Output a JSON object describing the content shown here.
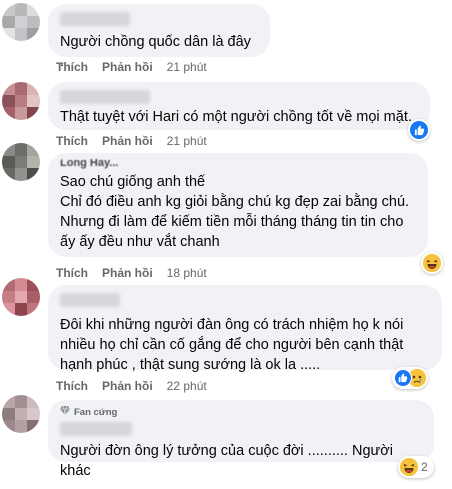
{
  "actions": {
    "like": "Thích",
    "reply": "Phản hồi"
  },
  "comments": [
    {
      "text": "Người chồng quốc dân là đây .",
      "time": "21 phút",
      "avatar_colors": [
        "#c9c9cb",
        "#b8b8bb",
        "#dcdcdd",
        "#a9a8ab",
        "#d0cfd2",
        "#bdbcc0",
        "#e2e2e3",
        "#c3c3c6",
        "#9f9ea2"
      ]
    },
    {
      "text": "Thật tuyệt với Hari có một người chồng tốt về mọi mặt.",
      "time": "21 phút",
      "avatar_colors": [
        "#c48f92",
        "#a86a70",
        "#d8b3b4",
        "#8c5259",
        "#b97c80",
        "#e1c4c4",
        "#a46066",
        "#c99a9c",
        "#7f474d"
      ]
    },
    {
      "author_fragment": "Long Hay...",
      "text": "Sao chú giống anh thế\nChỉ đó điều anh kg giỏi bằng chú kg đẹp zai bằng chú.\nNhưng đi làm để kiếm tiền mỗi tháng tháng tin tin cho ấy ấy đều như vắt chanh",
      "time": "18 phút",
      "avatar_colors": [
        "#8b8a86",
        "#6e6d69",
        "#a5a39e",
        "#5a5955",
        "#7c7b77",
        "#b4b2ad",
        "#696864",
        "#94928e",
        "#4f4e4a"
      ]
    },
    {
      "text": "Đôi khi những người đàn ông có trách nhiệm họ k nói nhiều họ chỉ cần cố gắng để cho người bên cạnh thật hạnh phúc , thật sung sướng là ok la .....",
      "time": "22 phút",
      "avatar_colors": [
        "#b46a72",
        "#d48b92",
        "#9a5059",
        "#c77d85",
        "#e3a7ad",
        "#a85e66",
        "#d9959b",
        "#8e454d",
        "#c2737b"
      ]
    },
    {
      "badge": "Fan cứng",
      "text": "Người đờn ông lý tưởng của cuộc đời .......... Người khác",
      "time": "",
      "avatar_colors": [
        "#b9a6a8",
        "#a28f92",
        "#cdbcbe",
        "#8e7b7e",
        "#c2afb1",
        "#d7c8ca",
        "#9c888b",
        "#b3a0a2",
        "#857174"
      ],
      "reaction_count": "2"
    }
  ],
  "colors": {
    "bubble": "#f0f2f5",
    "meta": "#65676b",
    "like_blue": "#1877f2",
    "haha_yellow": "#f7c33e"
  },
  "icons": [
    "like-icon",
    "haha-icon",
    "sad-icon",
    "diamond-icon"
  ]
}
